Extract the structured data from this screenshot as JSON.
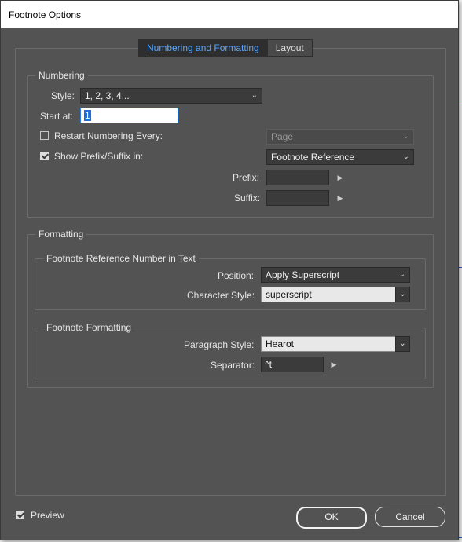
{
  "window": {
    "title": "Footnote Options"
  },
  "tabs": [
    {
      "label": "Numbering and Formatting",
      "active": true
    },
    {
      "label": "Layout",
      "active": false
    }
  ],
  "numbering": {
    "legend": "Numbering",
    "style_label": "Style:",
    "style_value": "1, 2, 3, 4...",
    "start_at_label": "Start at:",
    "start_at_value": "1",
    "restart_label": "Restart Numbering Every:",
    "restart_checked": false,
    "restart_value": "Page",
    "show_prefix_label": "Show Prefix/Suffix in:",
    "show_prefix_checked": true,
    "show_prefix_value": "Footnote Reference",
    "prefix_label": "Prefix:",
    "prefix_value": "",
    "suffix_label": "Suffix:",
    "suffix_value": ""
  },
  "formatting": {
    "legend": "Formatting",
    "reference": {
      "legend": "Footnote Reference Number in Text",
      "position_label": "Position:",
      "position_value": "Apply Superscript",
      "char_style_label": "Character Style:",
      "char_style_value": "superscript"
    },
    "footnote": {
      "legend": "Footnote Formatting",
      "para_style_label": "Paragraph Style:",
      "para_style_value": "Hearot",
      "separator_label": "Separator:",
      "separator_value": "^t"
    }
  },
  "footer": {
    "preview_label": "Preview",
    "preview_checked": true,
    "ok_label": "OK",
    "cancel_label": "Cancel"
  },
  "colors": {
    "dialog_bg": "#535353",
    "active_tab_text": "#5aa7ff",
    "field_bg": "#3b3b3b"
  },
  "icons": {
    "dropdown": "chevron-down-icon",
    "flyout": "triangle-right-icon",
    "checkbox": "check-icon"
  }
}
